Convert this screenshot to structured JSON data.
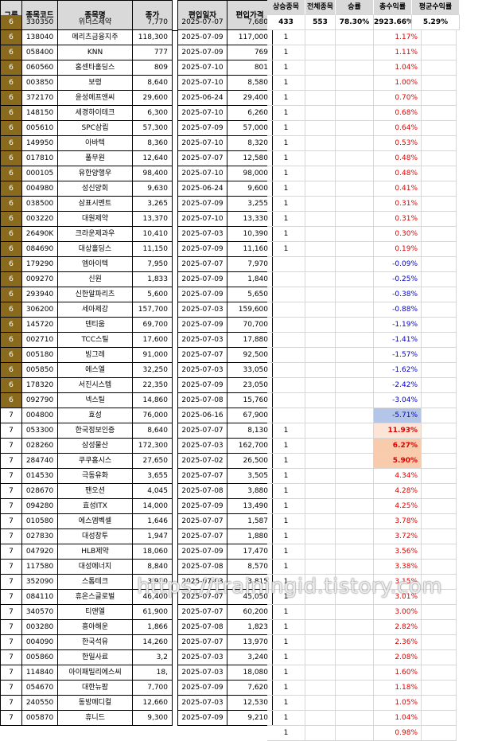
{
  "headers": {
    "group": "그룹",
    "code": "종목코드",
    "name": "종목명",
    "price": "종가",
    "entry_date": "편입일자",
    "entry_price": "편입가격"
  },
  "summary": {
    "labels": [
      "상승종목",
      "전체종목",
      "승률",
      "총수익률",
      "평균수익률"
    ],
    "values": [
      "433",
      "553",
      "78.30%",
      "2923.66%",
      "5.29%"
    ]
  },
  "rows": [
    {
      "g": "6",
      "code": "330350",
      "name": "위더스제약",
      "price": "7,770",
      "date": "2025-07-07",
      "ep": "7,680",
      "up": "1",
      "ret": "1.17%"
    },
    {
      "g": "6",
      "code": "138040",
      "name": "메리츠금융지주",
      "price": "118,300",
      "date": "2025-07-09",
      "ep": "117,000",
      "up": "1",
      "ret": "1.11%"
    },
    {
      "g": "6",
      "code": "058400",
      "name": "KNN",
      "price": "777",
      "date": "2025-07-09",
      "ep": "769",
      "up": "1",
      "ret": "1.04%"
    },
    {
      "g": "6",
      "code": "060560",
      "name": "홈센타홀딩스",
      "price": "809",
      "date": "2025-07-10",
      "ep": "801",
      "up": "1",
      "ret": "1.00%"
    },
    {
      "g": "6",
      "code": "003850",
      "name": "보령",
      "price": "8,640",
      "date": "2025-07-10",
      "ep": "8,580",
      "up": "1",
      "ret": "0.70%"
    },
    {
      "g": "6",
      "code": "372170",
      "name": "윤성에프앤씨",
      "price": "29,600",
      "date": "2025-06-24",
      "ep": "29,400",
      "up": "1",
      "ret": "0.68%"
    },
    {
      "g": "6",
      "code": "148150",
      "name": "세경하이테크",
      "price": "6,300",
      "date": "2025-07-10",
      "ep": "6,260",
      "up": "1",
      "ret": "0.64%"
    },
    {
      "g": "6",
      "code": "005610",
      "name": "SPC삼립",
      "price": "57,300",
      "date": "2025-07-09",
      "ep": "57,000",
      "up": "1",
      "ret": "0.53%"
    },
    {
      "g": "6",
      "code": "149950",
      "name": "아바텍",
      "price": "8,360",
      "date": "2025-07-10",
      "ep": "8,320",
      "up": "1",
      "ret": "0.48%"
    },
    {
      "g": "6",
      "code": "017810",
      "name": "풀무원",
      "price": "12,640",
      "date": "2025-07-07",
      "ep": "12,580",
      "up": "1",
      "ret": "0.48%"
    },
    {
      "g": "6",
      "code": "000105",
      "name": "유한양행우",
      "price": "98,400",
      "date": "2025-07-10",
      "ep": "98,000",
      "up": "1",
      "ret": "0.41%"
    },
    {
      "g": "6",
      "code": "004980",
      "name": "성신양회",
      "price": "9,630",
      "date": "2025-06-24",
      "ep": "9,600",
      "up": "1",
      "ret": "0.31%"
    },
    {
      "g": "6",
      "code": "038500",
      "name": "삼표시멘트",
      "price": "3,265",
      "date": "2025-07-09",
      "ep": "3,255",
      "up": "1",
      "ret": "0.31%"
    },
    {
      "g": "6",
      "code": "003220",
      "name": "대원제약",
      "price": "13,370",
      "date": "2025-07-10",
      "ep": "13,330",
      "up": "1",
      "ret": "0.30%"
    },
    {
      "g": "6",
      "code": "26490K",
      "name": "크라운제과우",
      "price": "10,410",
      "date": "2025-07-03",
      "ep": "10,390",
      "up": "1",
      "ret": "0.19%"
    },
    {
      "g": "6",
      "code": "084690",
      "name": "대상홀딩스",
      "price": "11,150",
      "date": "2025-07-09",
      "ep": "11,160",
      "up": "",
      "ret": "-0.09%"
    },
    {
      "g": "6",
      "code": "179290",
      "name": "엠아이텍",
      "price": "7,950",
      "date": "2025-07-07",
      "ep": "7,970",
      "up": "",
      "ret": "-0.25%"
    },
    {
      "g": "6",
      "code": "009270",
      "name": "신원",
      "price": "1,833",
      "date": "2025-07-09",
      "ep": "1,840",
      "up": "",
      "ret": "-0.38%"
    },
    {
      "g": "6",
      "code": "293940",
      "name": "신한알파리츠",
      "price": "5,600",
      "date": "2025-07-09",
      "ep": "5,650",
      "up": "",
      "ret": "-0.88%"
    },
    {
      "g": "6",
      "code": "306200",
      "name": "세아제강",
      "price": "157,700",
      "date": "2025-07-03",
      "ep": "159,600",
      "up": "",
      "ret": "-1.19%"
    },
    {
      "g": "6",
      "code": "145720",
      "name": "덴티움",
      "price": "69,700",
      "date": "2025-07-09",
      "ep": "70,700",
      "up": "",
      "ret": "-1.41%"
    },
    {
      "g": "6",
      "code": "002710",
      "name": "TCC스틸",
      "price": "17,600",
      "date": "2025-07-03",
      "ep": "17,880",
      "up": "",
      "ret": "-1.57%"
    },
    {
      "g": "6",
      "code": "005180",
      "name": "빙그레",
      "price": "91,000",
      "date": "2025-07-07",
      "ep": "92,500",
      "up": "",
      "ret": "-1.62%"
    },
    {
      "g": "6",
      "code": "005850",
      "name": "에스엘",
      "price": "32,250",
      "date": "2025-07-03",
      "ep": "33,050",
      "up": "",
      "ret": "-2.42%"
    },
    {
      "g": "6",
      "code": "178320",
      "name": "서진시스템",
      "price": "22,350",
      "date": "2025-07-09",
      "ep": "23,050",
      "up": "",
      "ret": "-3.04%"
    },
    {
      "g": "6",
      "code": "092790",
      "name": "넥스틸",
      "price": "14,860",
      "date": "2025-07-08",
      "ep": "15,760",
      "up": "",
      "ret": "-5.71%"
    },
    {
      "g": "7",
      "code": "004800",
      "name": "효성",
      "price": "76,000",
      "date": "2025-06-16",
      "ep": "67,900",
      "up": "1",
      "ret": "11.93%"
    },
    {
      "g": "7",
      "code": "053300",
      "name": "한국정보인증",
      "price": "8,640",
      "date": "2025-07-07",
      "ep": "8,130",
      "up": "1",
      "ret": "6.27%"
    },
    {
      "g": "7",
      "code": "028260",
      "name": "삼성물산",
      "price": "172,300",
      "date": "2025-07-03",
      "ep": "162,700",
      "up": "1",
      "ret": "5.90%"
    },
    {
      "g": "7",
      "code": "284740",
      "name": "쿠쿠홈시스",
      "price": "27,650",
      "date": "2025-07-02",
      "ep": "26,500",
      "up": "1",
      "ret": "4.34%"
    },
    {
      "g": "7",
      "code": "014530",
      "name": "극동유화",
      "price": "3,655",
      "date": "2025-07-07",
      "ep": "3,505",
      "up": "1",
      "ret": "4.28%"
    },
    {
      "g": "7",
      "code": "028670",
      "name": "팬오션",
      "price": "4,045",
      "date": "2025-07-08",
      "ep": "3,880",
      "up": "1",
      "ret": "4.25%"
    },
    {
      "g": "7",
      "code": "094280",
      "name": "효성ITX",
      "price": "14,000",
      "date": "2025-07-09",
      "ep": "13,490",
      "up": "1",
      "ret": "3.78%"
    },
    {
      "g": "7",
      "code": "010580",
      "name": "에스엠벡셀",
      "price": "1,646",
      "date": "2025-07-07",
      "ep": "1,587",
      "up": "1",
      "ret": "3.72%"
    },
    {
      "g": "7",
      "code": "027830",
      "name": "대성창투",
      "price": "1,947",
      "date": "2025-07-07",
      "ep": "1,880",
      "up": "1",
      "ret": "3.56%"
    },
    {
      "g": "7",
      "code": "047920",
      "name": "HLB제약",
      "price": "18,060",
      "date": "2025-07-09",
      "ep": "17,470",
      "up": "1",
      "ret": "3.38%"
    },
    {
      "g": "7",
      "code": "117580",
      "name": "대성에너지",
      "price": "8,840",
      "date": "2025-07-08",
      "ep": "8,570",
      "up": "1",
      "ret": "3.15%"
    },
    {
      "g": "7",
      "code": "352090",
      "name": "스톰테크",
      "price": "3,930",
      "date": "2025-07-03",
      "ep": "3,815",
      "up": "1",
      "ret": "3.01%"
    },
    {
      "g": "7",
      "code": "084110",
      "name": "휴온스글로벌",
      "price": "46,400",
      "date": "2025-07-07",
      "ep": "45,050",
      "up": "1",
      "ret": "3.00%"
    },
    {
      "g": "7",
      "code": "340570",
      "name": "티앤엘",
      "price": "61,900",
      "date": "2025-07-07",
      "ep": "60,200",
      "up": "1",
      "ret": "2.82%"
    },
    {
      "g": "7",
      "code": "003280",
      "name": "흥아해운",
      "price": "1,866",
      "date": "2025-07-08",
      "ep": "1,823",
      "up": "1",
      "ret": "2.36%"
    },
    {
      "g": "7",
      "code": "004090",
      "name": "한국석유",
      "price": "14,260",
      "date": "2025-07-07",
      "ep": "13,970",
      "up": "1",
      "ret": "2.08%"
    },
    {
      "g": "7",
      "code": "005860",
      "name": "한일사료",
      "price": "3,2",
      "date": "2025-07-03",
      "ep": "3,240",
      "up": "1",
      "ret": "1.60%"
    },
    {
      "g": "7",
      "code": "114840",
      "name": "아이패밀리에스씨",
      "price": "18,",
      "date": "2025-07-03",
      "ep": "18,080",
      "up": "1",
      "ret": "1.18%"
    },
    {
      "g": "7",
      "code": "054670",
      "name": "대한뉴팜",
      "price": "7,700",
      "date": "2025-07-09",
      "ep": "7,620",
      "up": "1",
      "ret": "1.05%"
    },
    {
      "g": "7",
      "code": "240550",
      "name": "동방메디컬",
      "price": "12,660",
      "date": "2025-07-03",
      "ep": "12,530",
      "up": "1",
      "ret": "1.04%"
    },
    {
      "g": "7",
      "code": "005870",
      "name": "휴니드",
      "price": "9,300",
      "date": "2025-07-09",
      "ep": "9,210",
      "up": "1",
      "ret": "0.98%"
    }
  ],
  "colors": {
    "group6_fill": "#8a6a1c",
    "positive": "#e00000",
    "negative": "#0000cc",
    "highlight_blue": "#b4c6e7",
    "highlight_orange": "#f8cbad",
    "highlight_light_orange": "#fce4d6"
  },
  "watermark": "https://trainingid.tistory.com"
}
